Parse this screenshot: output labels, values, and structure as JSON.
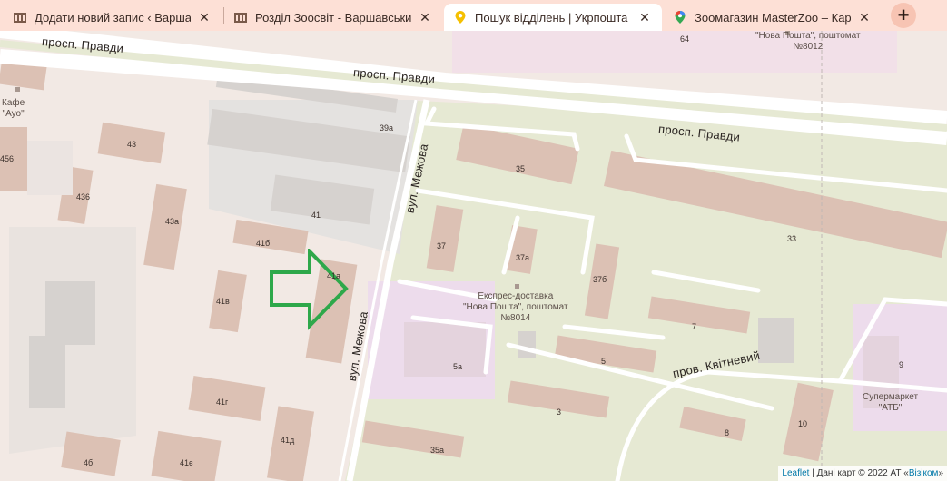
{
  "tabs": [
    {
      "title": "Додати новий запис ‹ Варшавсь",
      "icon": "building-icon",
      "active": false
    },
    {
      "title": "Розділ Зоосвіт - Варшавський к",
      "icon": "building-icon",
      "active": false
    },
    {
      "title": "Пошук відділень | Укрпошта",
      "icon": "location-pin-icon",
      "active": true
    },
    {
      "title": "Зоомагазин MasterZoo – Карти",
      "icon": "maps-pin-icon",
      "active": false
    }
  ],
  "new_tab_label": "+",
  "close_label": "✕",
  "roads": {
    "pravdy_1": "просп. Правди",
    "pravdy_2": "просп. Правди",
    "pravdy_3": "просп. Правди",
    "mezhova_1": "вул. Межова",
    "mezhova_2": "вул. Межова",
    "kvitnevyi": "пров. Квітневий"
  },
  "houses": {
    "h64": "64",
    "h43": "43",
    "h456": "456",
    "h436": "436",
    "h43a": "43а",
    "h39a": "39а",
    "h41": "41",
    "h41b": "41б",
    "h41a": "41а",
    "h41v": "41в",
    "h41g": "41г",
    "h41d": "41д",
    "h41e": "41є",
    "h46": "4б",
    "h35": "35",
    "h37": "37",
    "h37a": "37а",
    "h376": "37б",
    "h33": "33",
    "h7": "7",
    "h5a": "5а",
    "h5": "5",
    "h3": "3",
    "h35a": "35а",
    "h8": "8",
    "h10": "10",
    "h9": "9"
  },
  "pois": {
    "cafe_1": "Кафе",
    "cafe_2": "\"Ауо\"",
    "np_top_1": "\"Нова Пошта\", поштомат",
    "np_top_2": "№8012",
    "np_1": "Експрес-доставка",
    "np_2": "\"Нова Пошта\", поштомат",
    "np_3": "№8014",
    "atb_1": "Супермаркет",
    "atb_2": "\"АТБ\""
  },
  "attribution": {
    "leaflet": "Leaflet",
    "text": " | Дані карт © 2022 АТ «",
    "visicom": "Візіком",
    "end": "»"
  },
  "colors": {
    "tabbar": "#fde0d6",
    "arrow": "#2ea84a",
    "road": "#ffffff",
    "green_area": "#e4e8cf",
    "building": "#dcc1b4"
  }
}
